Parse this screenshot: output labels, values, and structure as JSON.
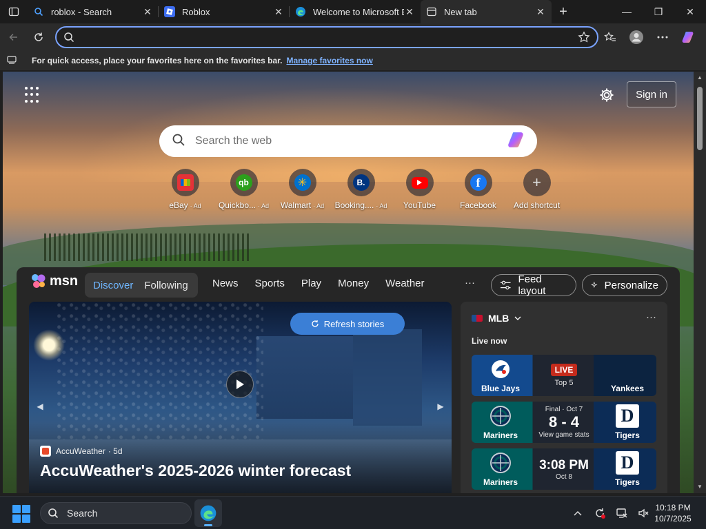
{
  "browser": {
    "tabs": [
      {
        "title": "roblox - Search",
        "icon": "search-icon"
      },
      {
        "title": "Roblox",
        "icon": "roblox-icon"
      },
      {
        "title": "Welcome to Microsoft E",
        "icon": "edge-icon"
      },
      {
        "title": "New tab",
        "icon": "newtab-icon",
        "active": true
      }
    ],
    "address": {
      "value": "",
      "placeholder": ""
    },
    "favorites_bar": {
      "message": "For quick access, place your favorites here on the favorites bar.",
      "link": "Manage favorites now"
    }
  },
  "newtab": {
    "sign_in": "Sign in",
    "search_placeholder": "Search the web",
    "shortcuts": [
      {
        "label": "eBay",
        "ad": "· Ad",
        "color": "#e53238",
        "glyph": ""
      },
      {
        "label": "Quickbo...",
        "ad": "· Ad",
        "color": "#2ca01c",
        "glyph": "qb"
      },
      {
        "label": "Walmart",
        "ad": "· Ad",
        "color": "#0071ce",
        "glyph": "✳"
      },
      {
        "label": "Booking....",
        "ad": "· Ad",
        "color": "#003580",
        "glyph": "B."
      },
      {
        "label": "YouTube",
        "ad": "",
        "color": "#ff0000",
        "glyph": ""
      },
      {
        "label": "Facebook",
        "ad": "",
        "color": "#1877f2",
        "glyph": "f"
      },
      {
        "label": "Add shortcut",
        "ad": "",
        "color": "#555555",
        "glyph": "+"
      }
    ]
  },
  "msn": {
    "logo": "msn",
    "pill": {
      "discover": "Discover",
      "following": "Following"
    },
    "nav": [
      "News",
      "Sports",
      "Play",
      "Money",
      "Weather"
    ],
    "more": "···",
    "feed_layout": "Feed layout",
    "personalize": "Personalize",
    "hero": {
      "refresh": "Refresh stories",
      "source": "AccuWeather",
      "age": "· 5d",
      "title": "AccuWeather's 2025-2026 winter forecast"
    },
    "sports": {
      "league": "MLB",
      "more": "···",
      "live_now": "Live now",
      "games": [
        {
          "left": "Blue Jays",
          "right": "Yankees",
          "status": "LIVE",
          "detail": "Top 5",
          "type": "live"
        },
        {
          "left": "Mariners",
          "right": "Tigers",
          "status": "Final · Oct 7",
          "score": "8 - 4",
          "detail": "View game stats",
          "type": "final"
        },
        {
          "left": "Mariners",
          "right": "Tigers",
          "time": "3:08 PM",
          "detail": "Oct 8",
          "type": "upcoming"
        }
      ]
    }
  },
  "taskbar": {
    "search": "Search",
    "time": "10:18 PM",
    "date": "10/7/2025"
  }
}
